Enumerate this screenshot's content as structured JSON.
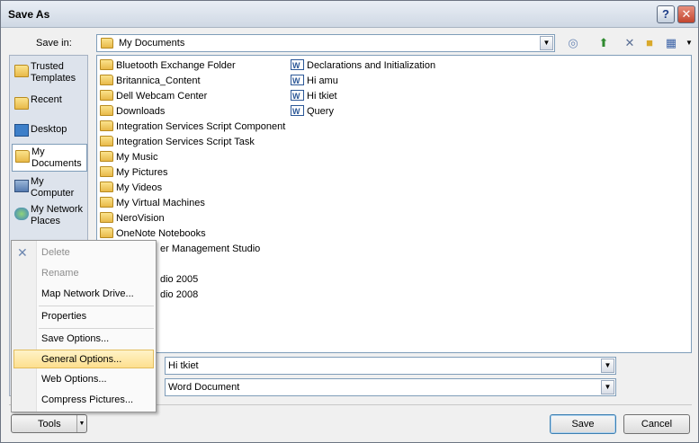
{
  "window": {
    "title": "Save As"
  },
  "save_in": {
    "label": "Save in:",
    "value": "My Documents"
  },
  "places": [
    {
      "label": "Trusted Templates",
      "icon": "folder-icon"
    },
    {
      "label": "Recent",
      "icon": "recent-folder-icon"
    },
    {
      "label": "Desktop",
      "icon": "desktop-icon"
    },
    {
      "label": "My Documents",
      "icon": "documents-icon",
      "selected": true
    },
    {
      "label": "My Computer",
      "icon": "computer-icon"
    },
    {
      "label": "My Network Places",
      "icon": "network-icon"
    }
  ],
  "files": {
    "col1": [
      "Bluetooth Exchange Folder",
      "Britannica_Content",
      "Dell Webcam Center",
      "Downloads",
      "Integration Services Script Component",
      "Integration Services Script Task",
      "My Music",
      "My Pictures",
      "My Videos",
      "My Virtual Machines",
      "NeroVision",
      "OneNote Notebooks",
      "er Management Studio",
      "",
      "dio 2005",
      "dio 2008"
    ],
    "col2": [
      "Declarations and Initialization",
      "Hi amu",
      "Hi tkiet",
      "Query"
    ]
  },
  "menu": {
    "items": [
      {
        "label": "Delete",
        "disabled": true
      },
      {
        "label": "Rename",
        "disabled": true
      },
      {
        "label": "Map Network Drive...",
        "disabled": false
      },
      {
        "label": "Properties",
        "disabled": false
      },
      {
        "label": "Save Options...",
        "disabled": false
      },
      {
        "label": "General Options...",
        "disabled": false,
        "highlighted": true
      },
      {
        "label": "Web Options...",
        "disabled": false
      },
      {
        "label": "Compress Pictures...",
        "disabled": false
      }
    ]
  },
  "filename": {
    "value": "Hi tkiet"
  },
  "filetype": {
    "value": "Word Document"
  },
  "buttons": {
    "tools": "Tools",
    "save": "Save",
    "cancel": "Cancel"
  }
}
